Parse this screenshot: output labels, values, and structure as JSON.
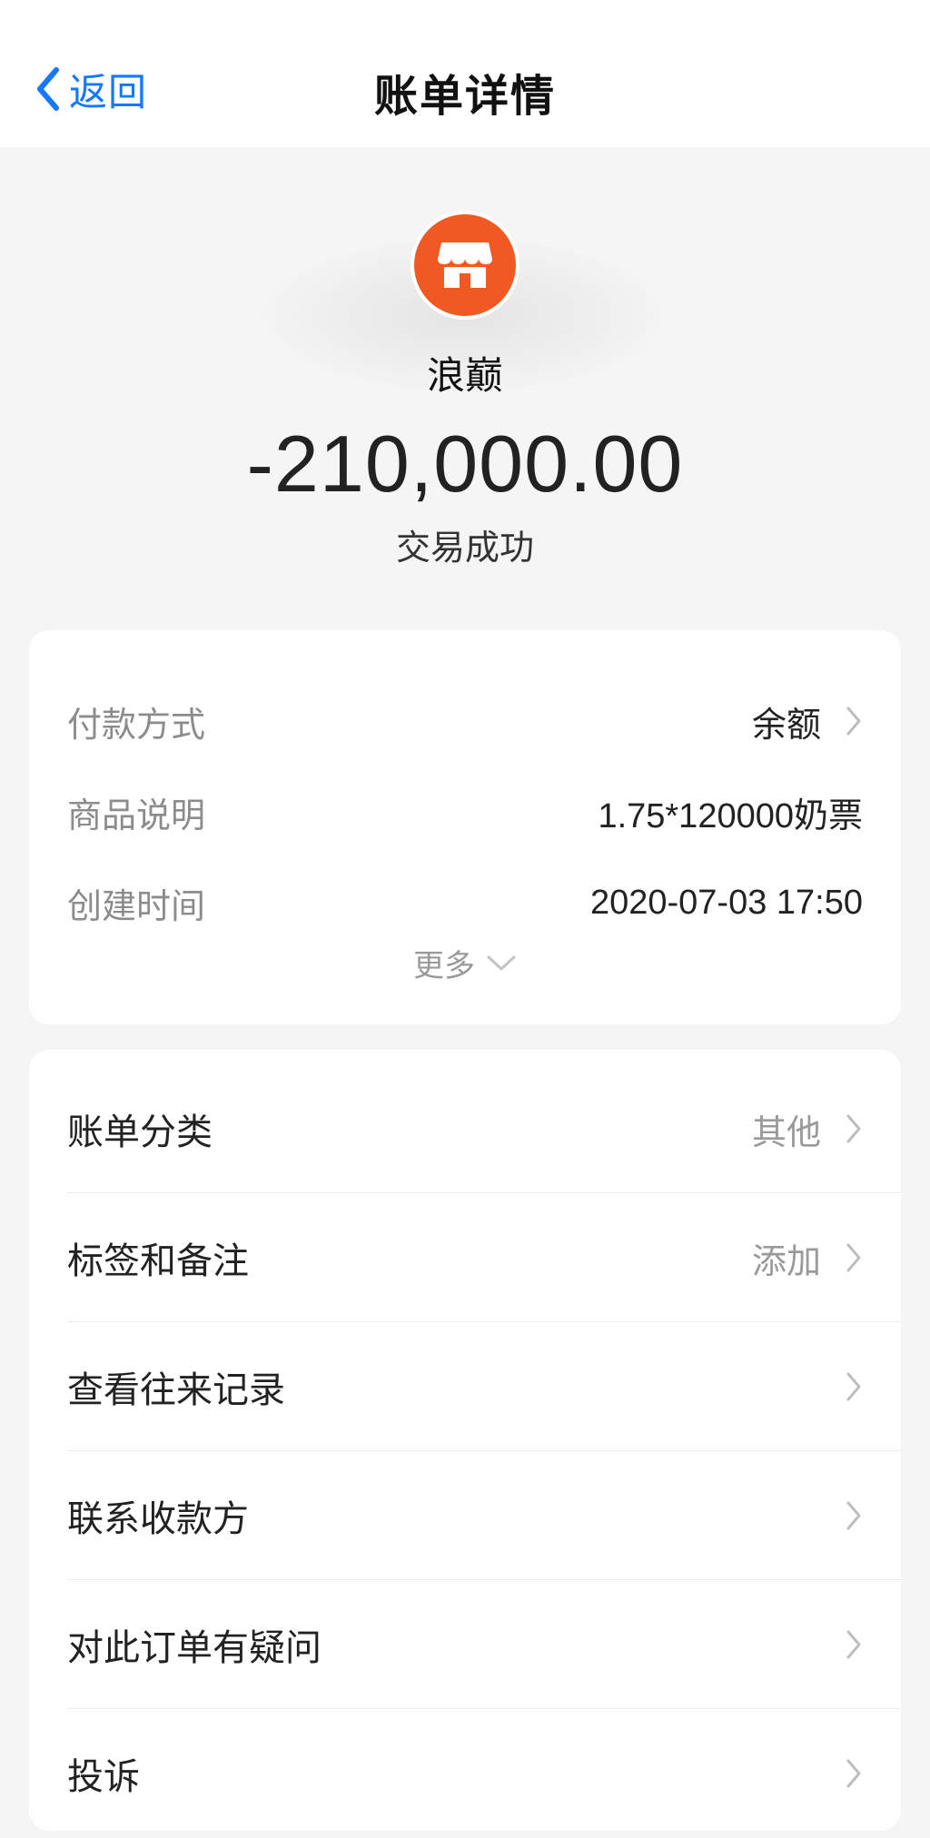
{
  "navbar": {
    "back_label": "返回",
    "title": "账单详情"
  },
  "summary": {
    "merchant_name": "浪巅",
    "amount": "-210,000.00",
    "status": "交易成功"
  },
  "details": {
    "rows": [
      {
        "label": "付款方式",
        "value": "余额"
      },
      {
        "label": "商品说明",
        "value": "1.75*120000奶票"
      },
      {
        "label": "创建时间",
        "value": "2020-07-03 17:50"
      }
    ],
    "more_label": "更多"
  },
  "actions": {
    "items": [
      {
        "label": "账单分类",
        "value": "其他"
      },
      {
        "label": "标签和备注",
        "value": "添加"
      },
      {
        "label": "查看往来记录",
        "value": ""
      },
      {
        "label": "联系收款方",
        "value": ""
      },
      {
        "label": "对此订单有疑问",
        "value": ""
      },
      {
        "label": "投诉",
        "value": ""
      }
    ]
  },
  "icons": {
    "back": "chevron-left-icon",
    "merchant": "storefront-icon",
    "row_arrow": "chevron-right-icon",
    "more": "chevron-down-icon"
  },
  "colors": {
    "accent": "#1677ff",
    "merchant_icon_bg": "#f05a22",
    "page_bg": "#f5f5f5",
    "muted_text": "#8c8c8c"
  }
}
